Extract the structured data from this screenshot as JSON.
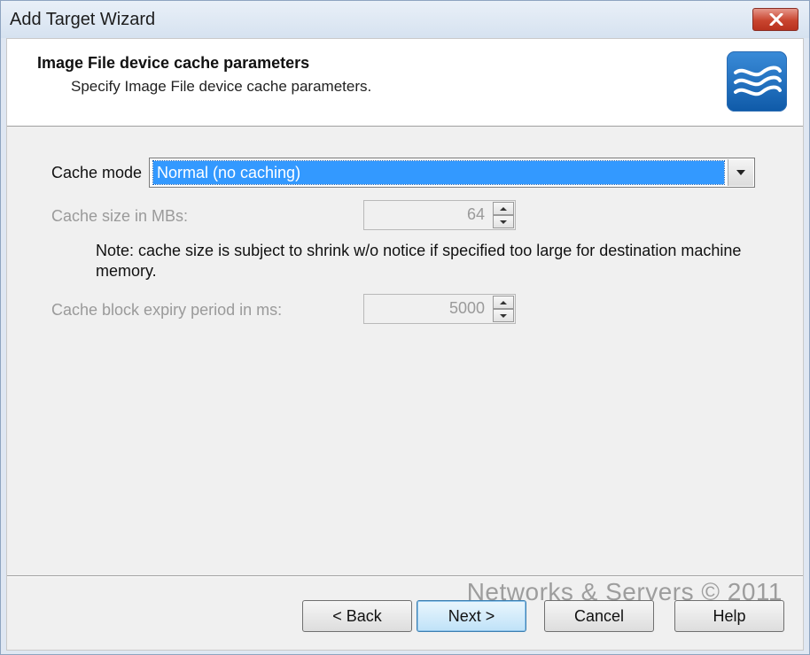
{
  "window": {
    "title": "Add Target Wizard"
  },
  "header": {
    "title": "Image File device cache parameters",
    "subtitle": "Specify Image File device cache parameters."
  },
  "form": {
    "cache_mode_label": "Cache mode",
    "cache_mode_value": "Normal (no caching)",
    "cache_size_label": "Cache size in MBs:",
    "cache_size_value": "64",
    "note": "Note: cache size is subject to shrink w/o notice if specified too large for destination machine memory.",
    "expiry_label": "Cache block expiry period in ms:",
    "expiry_value": "5000"
  },
  "buttons": {
    "back": "< Back",
    "next": "Next >",
    "cancel": "Cancel",
    "help": "Help"
  },
  "watermark": "Networks & Servers © 2011",
  "colors": {
    "selection": "#3399ff",
    "logo": "#1a6cc0",
    "close": "#c9452f"
  },
  "icons": {
    "close": "close-icon",
    "logo": "waves-logo-icon",
    "dropdown": "chevron-down-icon",
    "spin_up": "arrow-up-icon",
    "spin_down": "arrow-down-icon"
  }
}
